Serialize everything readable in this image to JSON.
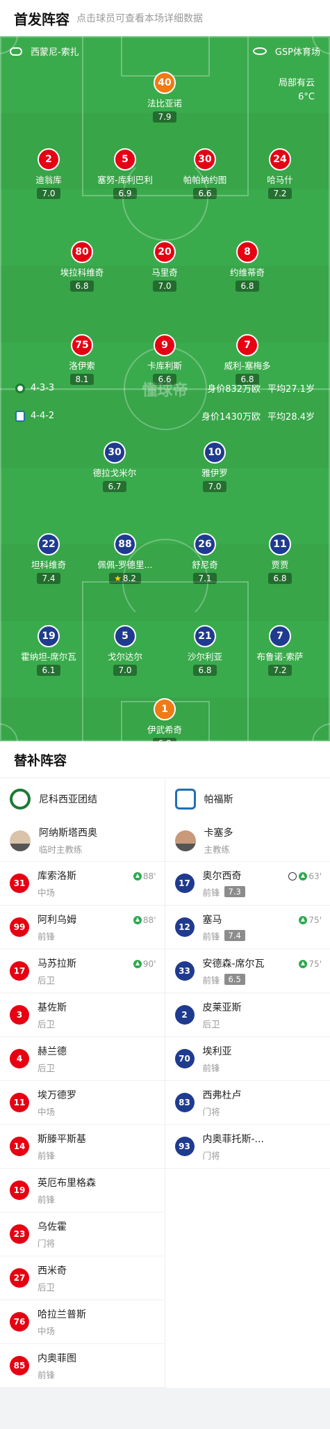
{
  "header": {
    "title": "首发阵容",
    "subtitle": "点击球员可查看本场详细数据"
  },
  "match": {
    "referee": "西蒙尼-索扎",
    "stadium": "GSP体育场",
    "weather": "局部有云",
    "temperature": "6°C",
    "watermark": "懂球帝"
  },
  "home": {
    "formation": "4-3-3",
    "value": "身价832万欧",
    "avg_age": "平均27.1岁"
  },
  "away": {
    "formation": "4-4-2",
    "value": "身价1430万欧",
    "avg_age": "平均28.4岁"
  },
  "home_players": [
    {
      "num": "40",
      "name": "法比亚诺",
      "rating": "7.9",
      "events": [],
      "captain": true,
      "gk": true
    },
    {
      "num": "2",
      "name": "迪翁库",
      "rating": "7.0",
      "events": [
        "sub"
      ],
      "ev_text": "90'"
    },
    {
      "num": "5",
      "name": "塞努-库利巴利",
      "rating": "6.9",
      "events": []
    },
    {
      "num": "30",
      "name": "帕帕纳约图",
      "rating": "6.6",
      "events": []
    },
    {
      "num": "24",
      "name": "哈马什",
      "rating": "7.2",
      "events": []
    },
    {
      "num": "80",
      "name": "埃拉科维奇",
      "rating": "6.8",
      "events": [
        "sub"
      ],
      "ev_text": "88'"
    },
    {
      "num": "20",
      "name": "马里奇",
      "rating": "7.0",
      "events": []
    },
    {
      "num": "8",
      "name": "约维蒂奇",
      "rating": "6.8",
      "events": [
        "yellow"
      ]
    },
    {
      "num": "75",
      "name": "洛伊索",
      "rating": "8.1",
      "events": []
    },
    {
      "num": "9",
      "name": "卡库利斯",
      "rating": "6.6",
      "events": [
        "yellow"
      ]
    },
    {
      "num": "7",
      "name": "威利-塞梅多",
      "rating": "6.8",
      "events": [
        "sub"
      ],
      "ev_text": "88'",
      "goal": true
    }
  ],
  "away_players": [
    {
      "num": "30",
      "name": "德拉戈米尔",
      "rating": "6.7",
      "events": []
    },
    {
      "num": "10",
      "name": "雅伊罗",
      "rating": "7.0",
      "events": [
        "sub"
      ],
      "ev_text": "75'",
      "captain": true
    },
    {
      "num": "22",
      "name": "坦科维奇",
      "rating": "7.4",
      "events": [
        "yellow"
      ]
    },
    {
      "num": "88",
      "name": "佩佩-罗德里...",
      "rating": "8.2",
      "events": [],
      "star": true
    },
    {
      "num": "26",
      "name": "舒尼奇",
      "rating": "7.1",
      "events": []
    },
    {
      "num": "11",
      "name": "贾贾",
      "rating": "6.8",
      "events": [
        "sub"
      ],
      "ev_text": "63'"
    },
    {
      "num": "19",
      "name": "霍纳坦-席尔瓦",
      "rating": "6.1",
      "events": [
        "yellow",
        "sub"
      ],
      "ev_text": "75'"
    },
    {
      "num": "5",
      "name": "戈尔达尔",
      "rating": "7.0",
      "events": [
        "yellow"
      ]
    },
    {
      "num": "21",
      "name": "沙尔利亚",
      "rating": "6.8",
      "events": []
    },
    {
      "num": "7",
      "name": "布鲁诺-索萨",
      "rating": "7.2",
      "events": []
    },
    {
      "num": "1",
      "name": "伊武希奇",
      "rating": "6.8",
      "events": [],
      "gk": true
    }
  ],
  "subs_section": {
    "title": "替补阵容"
  },
  "subs_home": {
    "team": "尼科西亚团结",
    "coach": {
      "name": "阿纳斯塔西奥",
      "role": "临时主教练"
    },
    "players": [
      {
        "num": "31",
        "name": "库索洛斯",
        "pos": "中场",
        "ev": "88'"
      },
      {
        "num": "99",
        "name": "阿利乌姆",
        "pos": "前锋",
        "ev": "88'"
      },
      {
        "num": "17",
        "name": "马苏拉斯",
        "pos": "后卫",
        "ev": "90'"
      },
      {
        "num": "3",
        "name": "基佐斯",
        "pos": "后卫",
        "ev": ""
      },
      {
        "num": "4",
        "name": "赫兰德",
        "pos": "后卫",
        "ev": ""
      },
      {
        "num": "11",
        "name": "埃万德罗",
        "pos": "中场",
        "ev": ""
      },
      {
        "num": "14",
        "name": "斯滕平斯基",
        "pos": "前锋",
        "ev": ""
      },
      {
        "num": "19",
        "name": "英厄布里格森",
        "pos": "前锋",
        "ev": ""
      },
      {
        "num": "23",
        "name": "乌佐霍",
        "pos": "门将",
        "ev": ""
      },
      {
        "num": "27",
        "name": "西米奇",
        "pos": "后卫",
        "ev": ""
      },
      {
        "num": "76",
        "name": "哈拉兰普斯",
        "pos": "中场",
        "ev": ""
      },
      {
        "num": "85",
        "name": "内奥菲图",
        "pos": "前锋",
        "ev": ""
      }
    ]
  },
  "subs_away": {
    "team": "帕福斯",
    "coach": {
      "name": "卡塞多",
      "role": "主教练"
    },
    "players": [
      {
        "num": "17",
        "name": "奥尔西奇",
        "pos": "前锋",
        "rating": "7.3",
        "ev": "63'",
        "goal": true
      },
      {
        "num": "12",
        "name": "塞马",
        "pos": "前锋",
        "rating": "7.4",
        "ev": "75'"
      },
      {
        "num": "33",
        "name": "安德森-席尔瓦",
        "pos": "前锋",
        "rating": "6.5",
        "ev": "75'"
      },
      {
        "num": "2",
        "name": "皮莱亚斯",
        "pos": "后卫",
        "rating": "",
        "ev": ""
      },
      {
        "num": "70",
        "name": "埃利亚",
        "pos": "前锋",
        "rating": "",
        "ev": ""
      },
      {
        "num": "83",
        "name": "西弗杜卢",
        "pos": "门将",
        "rating": "",
        "ev": ""
      },
      {
        "num": "93",
        "name": "内奥菲托斯-...",
        "pos": "门将",
        "rating": "",
        "ev": ""
      }
    ]
  },
  "colors": {
    "home": "#e60012",
    "away": "#1f3b8f",
    "gk": "#f07a13",
    "pitch": "#37a548"
  }
}
